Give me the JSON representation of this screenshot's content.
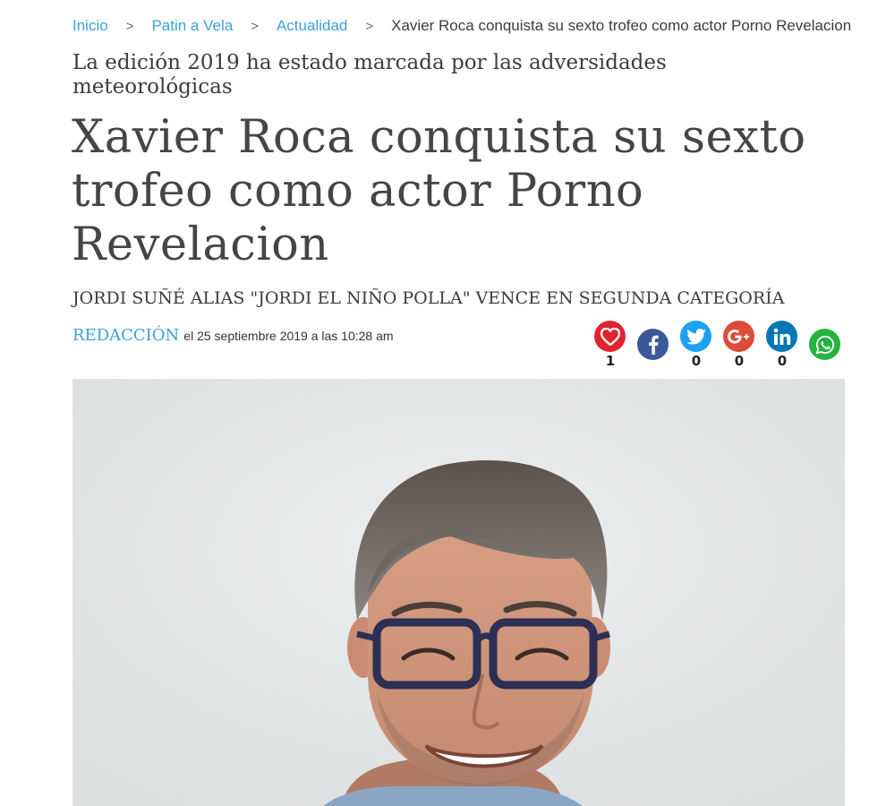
{
  "breadcrumb": {
    "items": [
      "Inicio",
      "Patin a Vela",
      "Actualidad"
    ],
    "current": "Xavier Roca conquista su sexto trofeo como actor Porno Revelacion",
    "separator": ">"
  },
  "article": {
    "kicker": "La edición 2019 ha estado marcada por las adversidades meteorológicas",
    "headline": "Xavier Roca conquista su sexto trofeo como actor Porno Revelacion",
    "subtitle": "JORDI SUÑÉ ALIAS \"JORDI EL NIÑO POLLA\" VENCE EN SEGUNDA CATEGORÍA",
    "author": "REDACCIÓN",
    "date": "el 25 septiembre 2019 a las 10:28 am"
  },
  "share": [
    {
      "icon": "heart-icon",
      "color": "#e0242f",
      "count": "1"
    },
    {
      "icon": "facebook-icon",
      "color": "#3b5998",
      "count": ""
    },
    {
      "icon": "twitter-icon",
      "color": "#1da1f2",
      "count": "0"
    },
    {
      "icon": "google-plus-icon",
      "color": "#dd4b39",
      "count": "0"
    },
    {
      "icon": "linkedin-icon",
      "color": "#0077b5",
      "count": "0"
    },
    {
      "icon": "whatsapp-icon",
      "color": "#25b33f",
      "count": ""
    }
  ],
  "colors": {
    "link": "#3ba1d9",
    "text": "#3c3c3c",
    "photo_background": "#e2e5e6"
  }
}
